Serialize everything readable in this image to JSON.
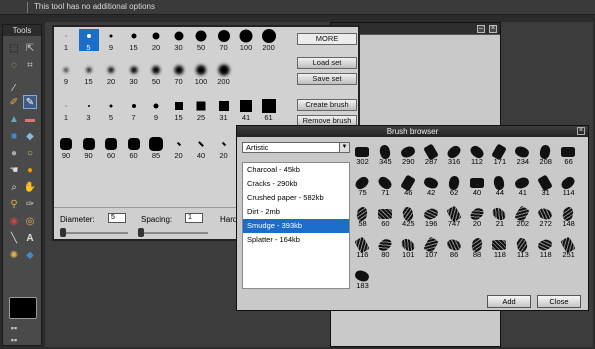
{
  "top_hint": "This tool has no additional options",
  "tools_title": "Tools",
  "colors": {
    "accent": "#1a6dc8"
  },
  "brush_sizes": [
    [
      "1",
      "5",
      "9",
      "15",
      "20",
      "30",
      "50",
      "70",
      "100",
      "200"
    ],
    [
      "9",
      "15",
      "20",
      "30",
      "50",
      "70",
      "100",
      "200"
    ],
    [
      "1",
      "3",
      "5",
      "7",
      "9",
      "15",
      "25",
      "31",
      "41",
      "61"
    ],
    [
      "90",
      "90",
      "60",
      "60",
      "85",
      "20",
      "40",
      "20"
    ]
  ],
  "panel_buttons": [
    "MORE",
    "Load set",
    "Save set",
    "Create brush",
    "Remove brush"
  ],
  "controls": {
    "diameter_label": "Diameter:",
    "diameter_value": "5",
    "spacing_label": "Spacing:",
    "spacing_value": "1",
    "hardness_label": "Hard"
  },
  "browser": {
    "title": "Brush browser",
    "category": "Artistic",
    "sets": [
      "Charcoal - 45kb",
      "Cracks - 290kb",
      "Crushed paper - 582kb",
      "Dirt - 2mb",
      "Smudge - 393kb",
      "Splatter - 164kb"
    ],
    "selected_set_index": 4,
    "brush_values": [
      [
        "302",
        "345",
        "290",
        "287",
        "316",
        "112",
        "171",
        "234",
        "208",
        "66"
      ],
      [
        "75",
        "71",
        "46",
        "42",
        "62",
        "40",
        "44",
        "41",
        "31",
        "114"
      ],
      [
        "58",
        "60",
        "425",
        "196",
        "747",
        "20",
        "21",
        "202",
        "272",
        "148"
      ],
      [
        "116",
        "80",
        "101",
        "107",
        "86",
        "88",
        "118",
        "113",
        "118",
        "251"
      ],
      [
        "183"
      ]
    ],
    "add_label": "Add",
    "close_label": "Close"
  }
}
